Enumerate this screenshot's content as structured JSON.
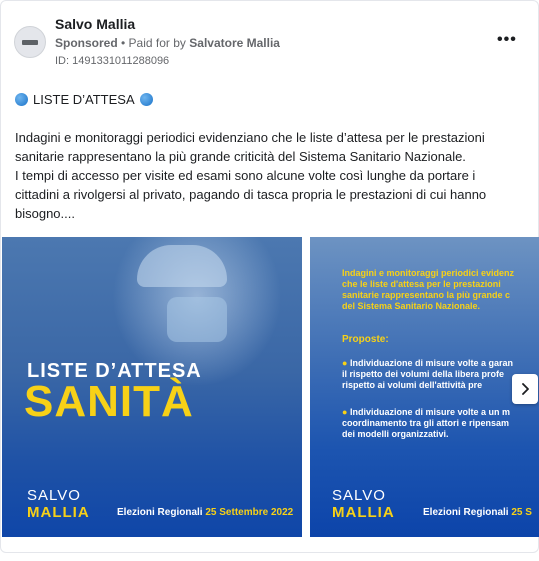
{
  "header": {
    "page_name": "Salvo Mallia",
    "sponsored": "Sponsored",
    "paid_prefix": "• Paid for by",
    "paid_by": "Salvatore Mallia",
    "ad_id": "ID: 1491331011288096",
    "menu_icon": "more-horizontal-icon"
  },
  "post": {
    "headline": "LISTE D’ATTESA",
    "body_line1": "Indagini e monitoraggi periodici evidenziano che le liste d’attesa per le prestazioni",
    "body_line2": "sanitarie rappresentano la più grande criticità del Sistema Sanitario Nazionale.",
    "body_line3": "I tempi di accesso per visite ed esami sono alcune volte così lunghe da portare i",
    "body_line4": "cittadini a rivolgersi al privato, pagando di tasca propria le prestazioni di cui hanno",
    "body_line5": "bisogno...."
  },
  "slide1": {
    "title_top": "LISTE D’ATTESA",
    "title_main": "SANITÀ",
    "brand_first": "SALVO",
    "brand_last": "MALLIA",
    "election_label": "Elezioni Regionali",
    "election_date": "25 Settembre 2022"
  },
  "slide2": {
    "intro_1": "Indagini e monitoraggi periodici evidenz",
    "intro_2": "che le liste d'attesa per le prestazioni",
    "intro_3": "sanitarie rappresentano la più grande c",
    "intro_4": "del Sistema Sanitario Nazionale.",
    "proposte": "Proposte:",
    "p1_1": "Individuazione di misure volte a garan",
    "p1_2": "il rispetto dei volumi della libera profe",
    "p1_3": "rispetto ai volumi dell'attività pre",
    "p2_1": "Individuazione di misure volte a un m",
    "p2_2": "coordinamento tra gli attori e ripensam",
    "p2_3": "dei modelli organizzativi.",
    "brand_first": "SALVO",
    "brand_last": "MALLIA",
    "election_label": "Elezioni Regionali",
    "election_date": "25 S"
  },
  "colors": {
    "accent_yellow": "#f7d117",
    "slide_blue": "#1f52a6",
    "text_grey": "#65676b"
  }
}
